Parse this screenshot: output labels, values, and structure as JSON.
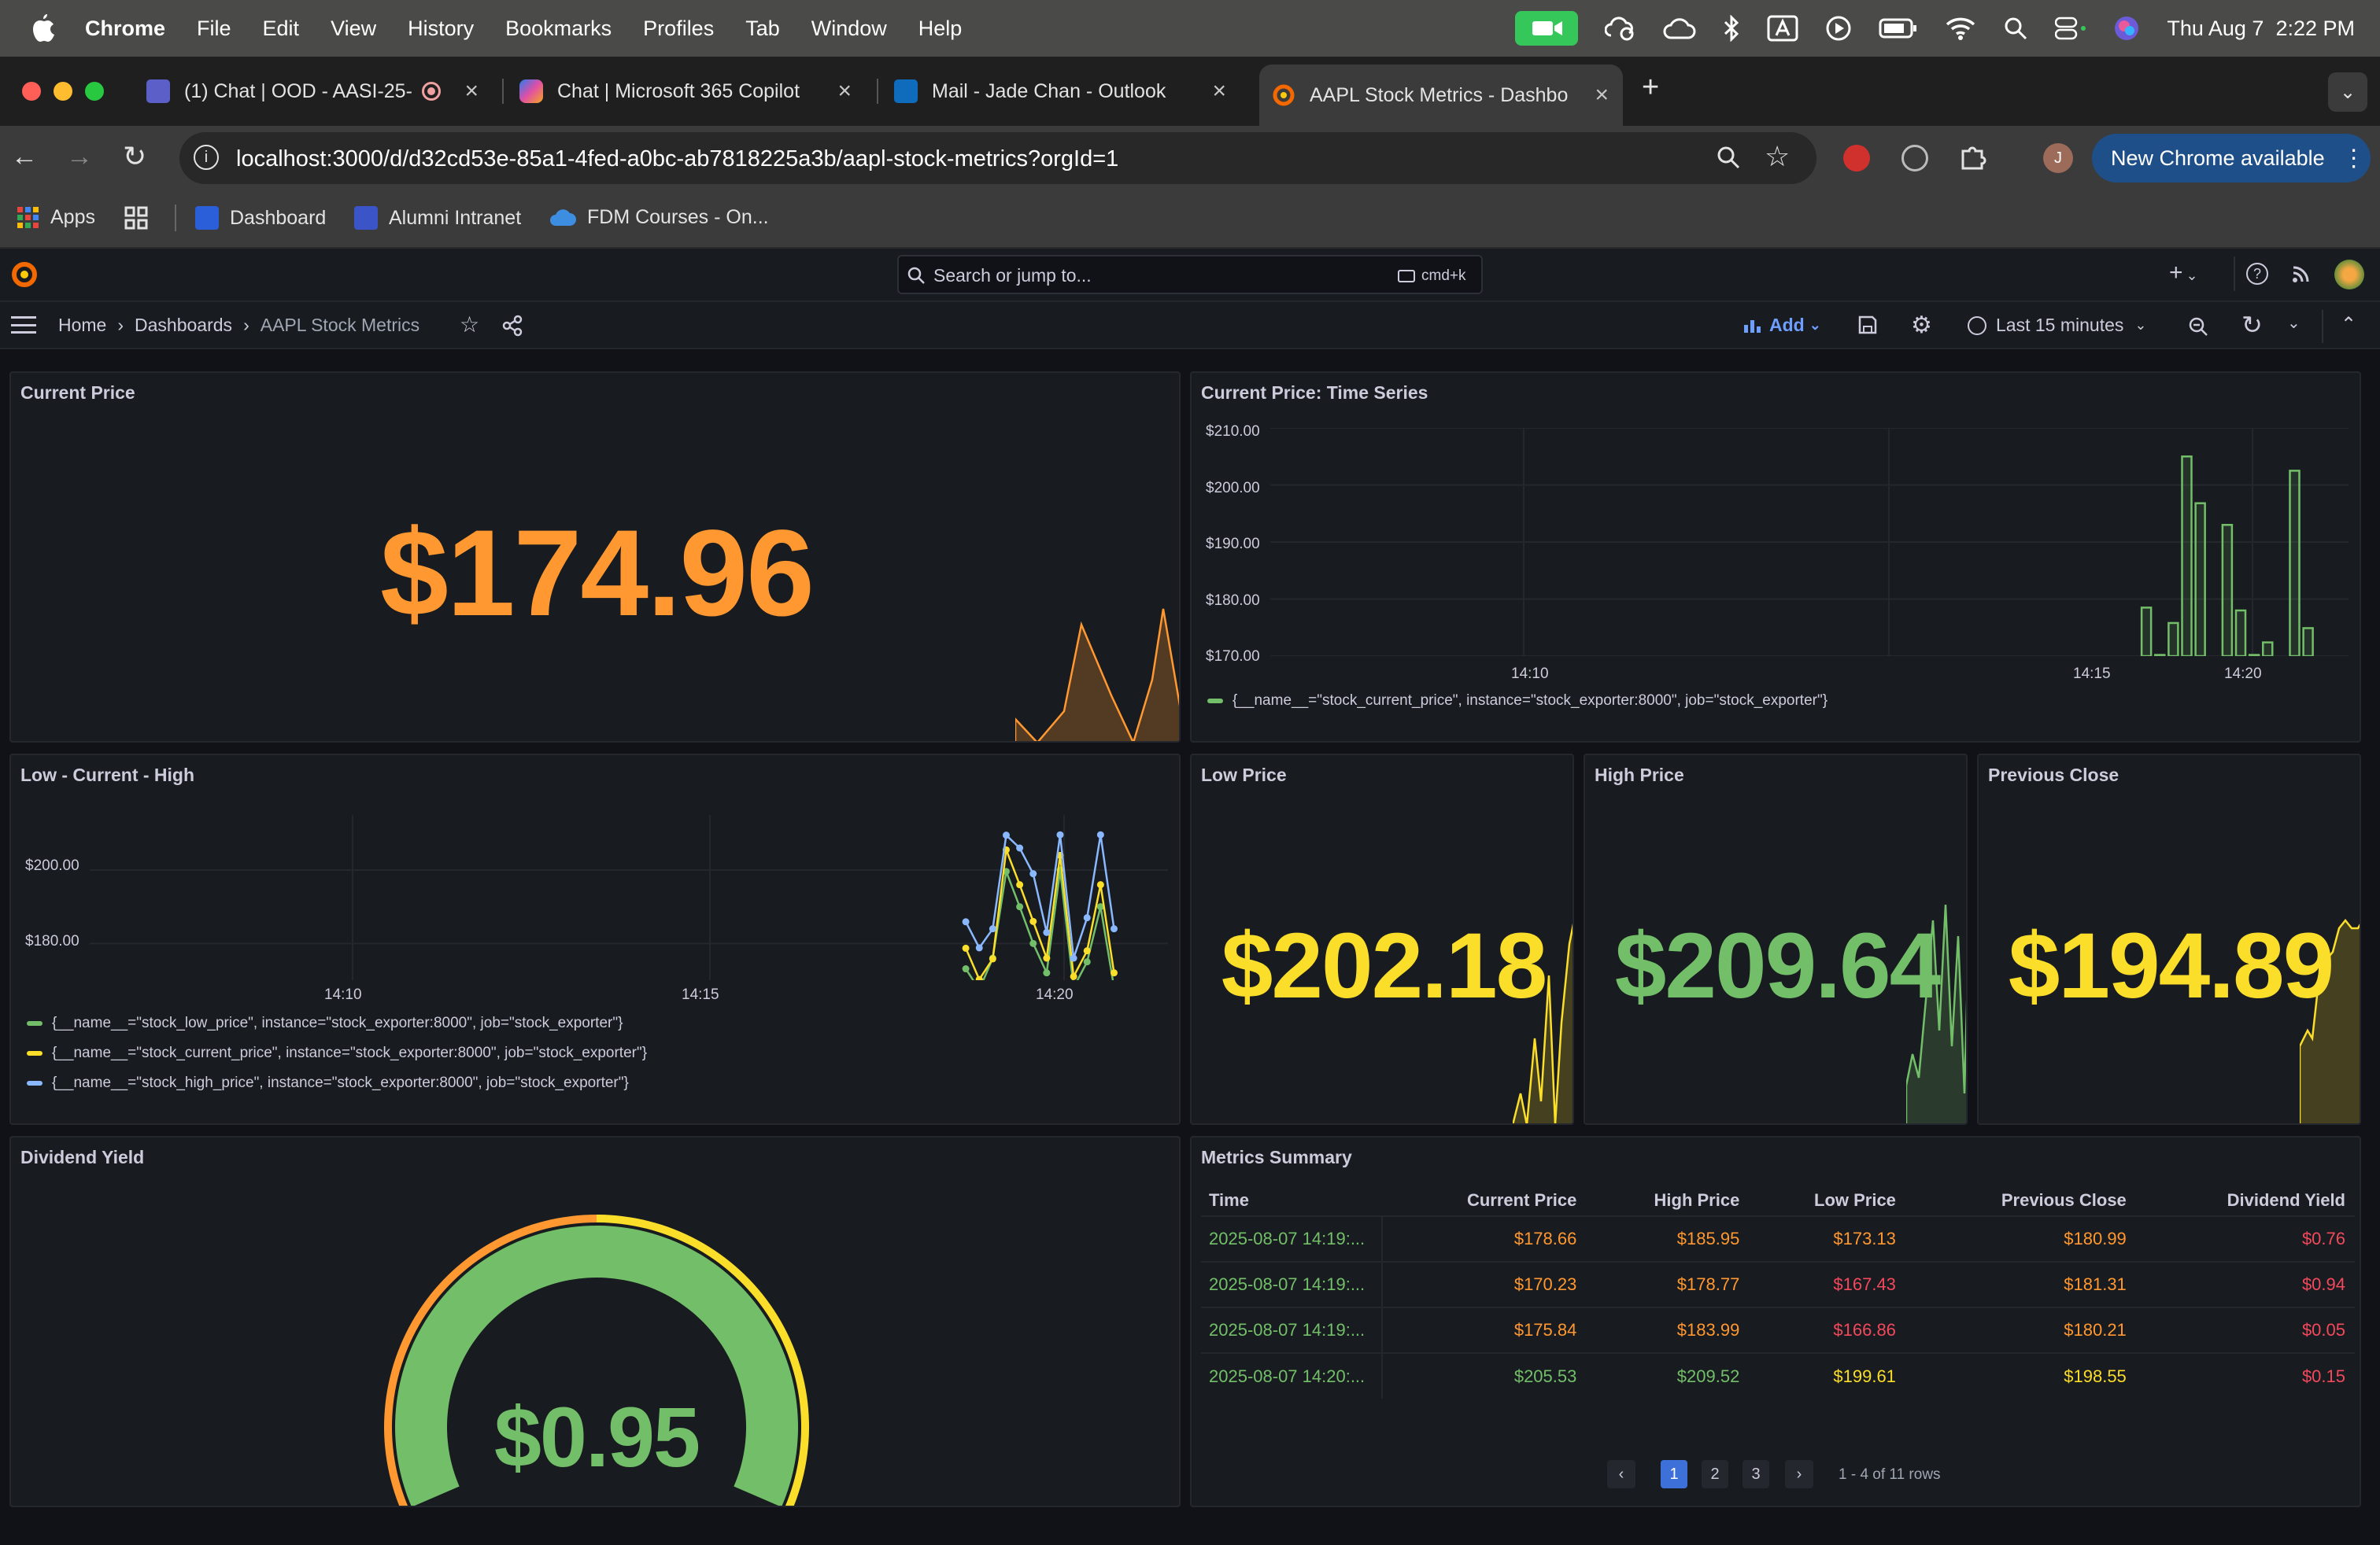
{
  "menubar": {
    "app": "Chrome",
    "items": [
      "File",
      "Edit",
      "View",
      "History",
      "Bookmarks",
      "Profiles",
      "Tab",
      "Window",
      "Help"
    ],
    "datetime": "Thu Aug 7  2:22 PM",
    "icons": [
      "facetime-icon",
      "cloud-battery-icon",
      "creative-cloud-icon",
      "bluetooth-icon",
      "text-input-icon",
      "play-icon",
      "battery-icon",
      "wifi-icon",
      "spotlight-icon",
      "control-center-icon",
      "siri-icon"
    ]
  },
  "tabs": [
    {
      "title": "(1) Chat | OOD - AASI-25-",
      "favicon": "teams-icon",
      "recording": true
    },
    {
      "title": "Chat | Microsoft 365 Copilot",
      "favicon": "copilot-icon"
    },
    {
      "title": "Mail - Jade Chan - Outlook",
      "favicon": "outlook-icon"
    },
    {
      "title": "AAPL Stock Metrics - Dashbo",
      "favicon": "grafana-icon",
      "active": true
    }
  ],
  "toolbar": {
    "url": "localhost:3000/d/d32cd53e-85a1-4fed-a0bc-ab7818225a3b/aapl-stock-metrics?orgId=1",
    "profile_initial": "J",
    "new_chrome": "New Chrome available"
  },
  "bookmarks": [
    "Apps",
    "Dashboard",
    "Alumni Intranet",
    "FDM Courses - On..."
  ],
  "grafana": {
    "search_placeholder": "Search or jump to...",
    "search_shortcut": "cmd+k",
    "breadcrumb": [
      "Home",
      "Dashboards",
      "AAPL Stock Metrics"
    ],
    "add_label": "Add",
    "time_range": "Last 15 minutes"
  },
  "panels": {
    "current_price": {
      "title": "Current Price",
      "value": "$174.96",
      "color": "#ff9830"
    },
    "time_series": {
      "title": "Current Price: Time Series",
      "legend": "{__name__=\"stock_current_price\", instance=\"stock_exporter:8000\", job=\"stock_exporter\"}"
    },
    "low_current_high": {
      "title": "Low - Current - High",
      "legend": [
        {
          "label": "{__name__=\"stock_low_price\", instance=\"stock_exporter:8000\", job=\"stock_exporter\"}",
          "color": "#73bf69"
        },
        {
          "label": "{__name__=\"stock_current_price\", instance=\"stock_exporter:8000\", job=\"stock_exporter\"}",
          "color": "#fade2a"
        },
        {
          "label": "{__name__=\"stock_high_price\", instance=\"stock_exporter:8000\", job=\"stock_exporter\"}",
          "color": "#8ab8ff"
        }
      ]
    },
    "low_price": {
      "title": "Low Price",
      "value": "$202.18",
      "color": "#fade2a"
    },
    "high_price": {
      "title": "High Price",
      "value": "$209.64",
      "color": "#73bf69"
    },
    "previous_close": {
      "title": "Previous Close",
      "value": "$194.89",
      "color": "#fade2a"
    },
    "dividend_yield": {
      "title": "Dividend Yield",
      "value": "$0.95",
      "color": "#73bf69"
    },
    "metrics_summary": {
      "title": "Metrics Summary",
      "columns": [
        "Time",
        "Current Price",
        "High Price",
        "Low Price",
        "Previous Close",
        "Dividend Yield"
      ],
      "rows": [
        [
          "2025-08-07 14:19:...",
          "$178.66",
          "$185.95",
          "$173.13",
          "$180.99",
          "$0.76"
        ],
        [
          "2025-08-07 14:19:...",
          "$170.23",
          "$178.77",
          "$167.43",
          "$181.31",
          "$0.94"
        ],
        [
          "2025-08-07 14:19:...",
          "$175.84",
          "$183.99",
          "$166.86",
          "$180.21",
          "$0.05"
        ],
        [
          "2025-08-07 14:20:...",
          "$205.53",
          "$209.52",
          "$199.61",
          "$198.55",
          "$0.15"
        ]
      ],
      "cell_colors": [
        [
          "#73bf69",
          "#ff9830",
          "#ff9830",
          "#ff9830",
          "#ff9830",
          "#f2495c"
        ],
        [
          "#73bf69",
          "#ff9830",
          "#ff9830",
          "#f2495c",
          "#ff9830",
          "#f2495c"
        ],
        [
          "#73bf69",
          "#ff9830",
          "#ff9830",
          "#f2495c",
          "#ff9830",
          "#f2495c"
        ],
        [
          "#73bf69",
          "#73bf69",
          "#73bf69",
          "#fade2a",
          "#fade2a",
          "#f2495c"
        ]
      ],
      "pages": [
        "1",
        "2",
        "3"
      ],
      "rows_info": "1 - 4 of 11 rows"
    }
  },
  "chart_data": [
    {
      "type": "bar",
      "title": "Current Price: Time Series",
      "y_ticks": [
        "$210.00",
        "$200.00",
        "$190.00",
        "$180.00",
        "$170.00"
      ],
      "x_ticks": [
        "14:10",
        "14:15",
        "14:20"
      ],
      "ylim": [
        170,
        210
      ],
      "x_range": [
        "14:06",
        "14:22"
      ],
      "x": [
        "14:19.0",
        "14:19.2",
        "14:19.4",
        "14:19.6",
        "14:19.8",
        "14:20.0",
        "14:20.2",
        "14:20.4",
        "14:20.6",
        "14:20.8",
        "14:21.0",
        "14:21.2",
        "14:21.4"
      ],
      "values": [
        178.5,
        170.2,
        175.8,
        205.0,
        196.8,
        170.0,
        193.0,
        178.0,
        170.2,
        172.4,
        170.0,
        202.5,
        174.9
      ],
      "series": [
        {
          "name": "{__name__=\"stock_current_price\", instance=\"stock_exporter:8000\", job=\"stock_exporter\"}",
          "color": "#73bf69"
        }
      ]
    },
    {
      "type": "line",
      "title": "Low - Current - High",
      "y_ticks": [
        "$200.00",
        "$180.00"
      ],
      "x_ticks": [
        "14:10",
        "14:15",
        "14:20"
      ],
      "ylim": [
        170,
        215
      ],
      "x_range": [
        "14:06",
        "14:22"
      ],
      "x": [
        "14:19.0",
        "14:19.2",
        "14:19.4",
        "14:19.6",
        "14:19.8",
        "14:20.0",
        "14:20.2",
        "14:20.4",
        "14:20.6",
        "14:20.8",
        "14:21.0",
        "14:21.2"
      ],
      "series": [
        {
          "name": "{__name__=\"stock_low_price\", instance=\"stock_exporter:8000\", job=\"stock_exporter\"}",
          "color": "#73bf69",
          "values": [
            173.1,
            167.4,
            176.0,
            199.6,
            190.0,
            180.0,
            172.0,
            200.0,
            168.0,
            175.0,
            190.0,
            168.0
          ]
        },
        {
          "name": "{__name__=\"stock_current_price\", instance=\"stock_exporter:8000\", job=\"stock_exporter\"}",
          "color": "#fade2a",
          "values": [
            178.7,
            170.2,
            175.8,
            205.5,
            196.0,
            186.0,
            176.0,
            204.0,
            171.0,
            178.0,
            196.0,
            172.0
          ]
        },
        {
          "name": "{__name__=\"stock_high_price\", instance=\"stock_exporter:8000\", job=\"stock_exporter\"}",
          "color": "#8ab8ff",
          "values": [
            185.9,
            178.8,
            184.0,
            209.5,
            206.0,
            199.0,
            183.0,
            209.6,
            176.0,
            187.0,
            209.6,
            184.0
          ]
        }
      ]
    }
  ]
}
